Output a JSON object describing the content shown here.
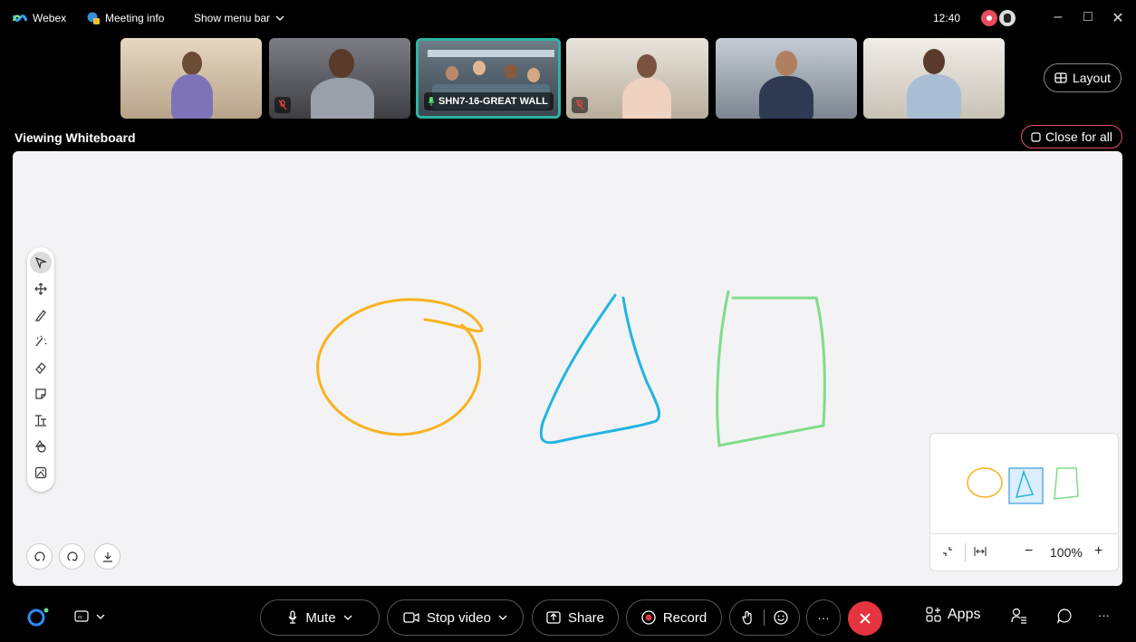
{
  "titlebar": {
    "app_name": "Webex",
    "meeting_info": "Meeting info",
    "show_menu_bar": "Show menu bar",
    "time": "12:40"
  },
  "participants": [
    {
      "muted": false,
      "label": ""
    },
    {
      "muted": true,
      "label": ""
    },
    {
      "muted": false,
      "label": "SHN7-16-GREAT WALL",
      "active": true
    },
    {
      "muted": true,
      "label": ""
    },
    {
      "muted": false,
      "label": ""
    },
    {
      "muted": false,
      "label": ""
    }
  ],
  "layout_button": "Layout",
  "viewing_label": "Viewing Whiteboard",
  "close_for_all": "Close for all",
  "whiteboard": {
    "shape_colors": {
      "circle": "#f7b21e",
      "triangle": "#22b4e0",
      "rectangle": "#7fdc8a"
    },
    "tools": [
      "select-icon",
      "move-icon",
      "pen-icon",
      "magic-pen-icon",
      "eraser-icon",
      "sticky-note-icon",
      "text-icon",
      "shapes-icon",
      "image-icon"
    ],
    "zoom": "100%",
    "zoom_minus": "−",
    "zoom_plus": "+"
  },
  "bottombar": {
    "mute": "Mute",
    "stop_video": "Stop video",
    "share": "Share",
    "record": "Record",
    "apps": "Apps",
    "end_color": "#e5333f"
  }
}
